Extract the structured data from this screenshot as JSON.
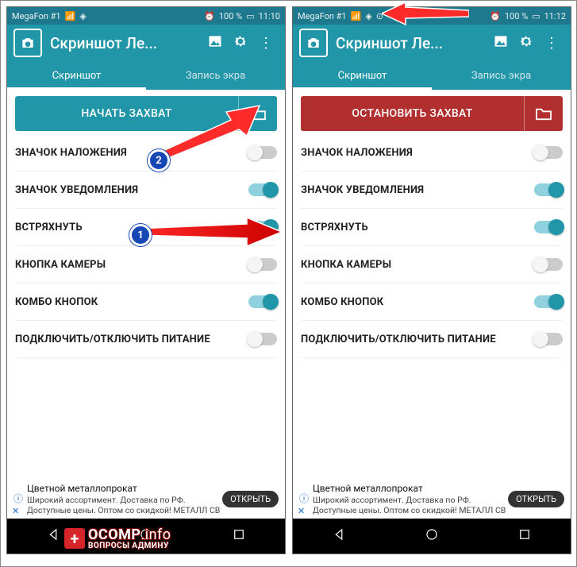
{
  "status": {
    "carrier": "MegaFon #1",
    "battery": "100 %"
  },
  "appbar": {
    "title": "Скриншот Ле..."
  },
  "tabs": {
    "active": "Скриншот",
    "inactive": "Запись экра"
  },
  "left": {
    "time": "11:10",
    "button_label": "НАЧАТЬ ЗАХВАТ",
    "rows": [
      {
        "label": "ЗНАЧОК НАЛОЖЕНИЯ",
        "on": false
      },
      {
        "label": "ЗНАЧОК УВЕДОМЛЕНИЯ",
        "on": true
      },
      {
        "label": "ВСТРЯХНУТЬ",
        "on": true
      },
      {
        "label": "КНОПКА КАМЕРЫ",
        "on": false
      },
      {
        "label": "КОМБО КНОПОК",
        "on": true
      },
      {
        "label": "ПОДКЛЮЧИТЬ/ОТКЛЮЧИТЬ ПИТАНИЕ",
        "on": false
      }
    ]
  },
  "right": {
    "time": "11:12",
    "button_label": "ОСТАНОВИТЬ ЗАХВАТ",
    "rows": [
      {
        "label": "ЗНАЧОК НАЛОЖЕНИЯ",
        "on": false
      },
      {
        "label": "ЗНАЧОК УВЕДОМЛЕНИЯ",
        "on": true
      },
      {
        "label": "ВСТРЯХНУТЬ",
        "on": true
      },
      {
        "label": "КНОПКА КАМЕРЫ",
        "on": false
      },
      {
        "label": "КОМБО КНОПОК",
        "on": true
      },
      {
        "label": "ПОДКЛЮЧИТЬ/ОТКЛЮЧИТЬ ПИТАНИЕ",
        "on": false
      }
    ]
  },
  "ad": {
    "title": "Цветной металлопрокат",
    "body": "Широкий ассортимент. Доставка по РФ. Доступные цены. Оптом со скидкой! МЕТАЛЛ СВ",
    "button": "ОТКРЫТЬ"
  },
  "watermark": {
    "line1_a": "OCOMP",
    "line1_b": ".info",
    "line2": "ВОПРОСЫ АДМИНУ"
  },
  "badges": {
    "b1": "1",
    "b2": "2"
  }
}
